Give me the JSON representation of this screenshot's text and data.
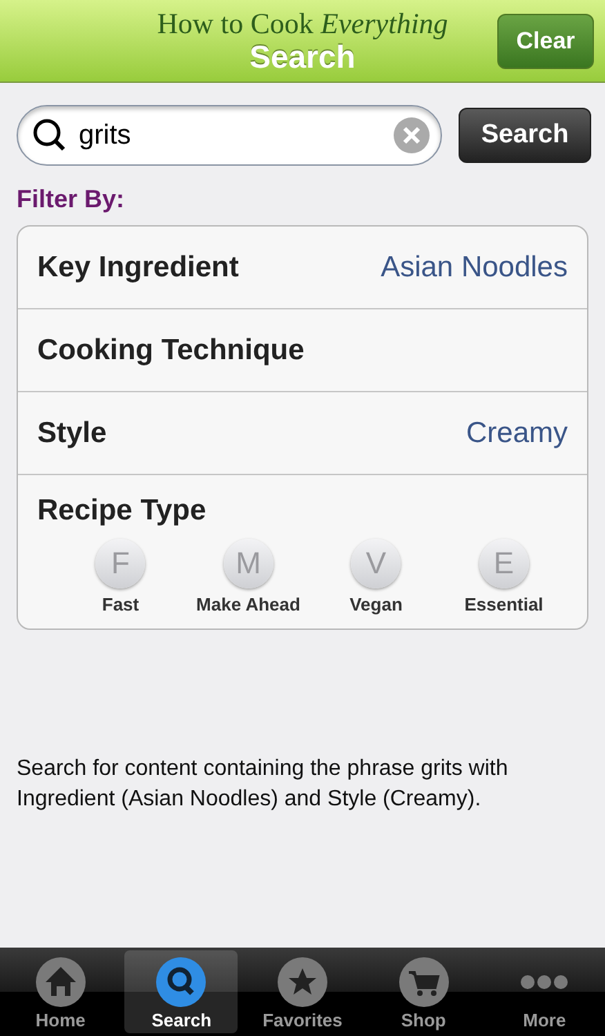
{
  "header": {
    "brand": "How to Cook *Everything*",
    "title": "Search",
    "clear_button": "Clear"
  },
  "search": {
    "value": "grits",
    "button": "Search"
  },
  "filter_label": "Filter By:",
  "filters": [
    {
      "label": "Key Ingredient",
      "value": "Asian Noodles"
    },
    {
      "label": "Cooking Technique"
    },
    {
      "label": "Style",
      "value": "Creamy"
    }
  ],
  "recipe_type": {
    "label": "Recipe Type",
    "options": [
      {
        "letter": "F",
        "label": "Fast",
        "selected": false
      },
      {
        "letter": "M",
        "label": "Make Ahead",
        "selected": false
      },
      {
        "letter": "V",
        "label": "Vegan",
        "selected": false
      },
      {
        "letter": "E",
        "label": "Essential",
        "selected": false
      }
    ]
  },
  "description": "Search for content containing the phrase grits with Ingredient (Asian Noodles) and Style (Creamy).",
  "tab_bar": [
    {
      "kind": "home",
      "label": "Home",
      "selected": false
    },
    {
      "kind": "search",
      "label": "Search",
      "selected": true
    },
    {
      "kind": "star",
      "label": "Favorites",
      "selected": false
    },
    {
      "kind": "cart",
      "label": "Shop",
      "selected": false
    },
    {
      "kind": "more",
      "label": "More",
      "selected": false
    }
  ]
}
